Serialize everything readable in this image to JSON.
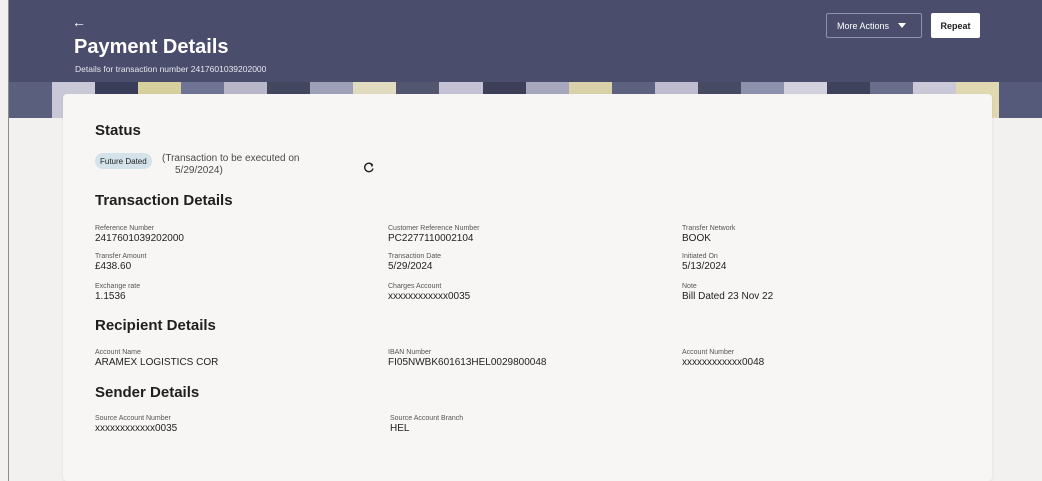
{
  "header": {
    "back_glyph": "←",
    "title": "Payment Details",
    "subtitle": "Details for transaction number 2417601039202000",
    "more_actions_label": "More Actions",
    "repeat_label": "Repeat",
    "background_color": "#4a4e6c"
  },
  "status": {
    "section_title": "Status",
    "badge": "Future Dated",
    "note_line1": "(Transaction to be executed on",
    "note_line2": "5/29/2024)",
    "refresh_icon": "refresh-icon"
  },
  "transaction_details": {
    "section_title": "Transaction Details",
    "fields": [
      {
        "label": "Reference Number",
        "value": "2417601039202000"
      },
      {
        "label": "Customer Reference Number",
        "value": "PC2277110002104"
      },
      {
        "label": "Transfer Network",
        "value": "BOOK"
      },
      {
        "label": "Transfer Amount",
        "value": "£438.60"
      },
      {
        "label": "Transaction Date",
        "value": "5/29/2024"
      },
      {
        "label": "Initiated On",
        "value": "5/13/2024"
      },
      {
        "label": "Exchange rate",
        "value": "1.1536"
      },
      {
        "label": "Charges Account",
        "value": "xxxxxxxxxxxx0035"
      },
      {
        "label": "Note",
        "value": "Bill Dated 23 Nov 22"
      }
    ]
  },
  "recipient_details": {
    "section_title": "Recipient Details",
    "fields": [
      {
        "label": "Account Name",
        "value": "ARAMEX LOGISTICS COR"
      },
      {
        "label": "IBAN Number",
        "value": "FI05NWBK601613HEL0029800048"
      },
      {
        "label": "Account Number",
        "value": "xxxxxxxxxxxx0048"
      }
    ]
  },
  "sender_details": {
    "section_title": "Sender Details",
    "fields": [
      {
        "label": "Source Account Number",
        "value": "xxxxxxxxxxxx0035"
      },
      {
        "label": "Source Account Branch",
        "value": "HEL"
      }
    ]
  }
}
